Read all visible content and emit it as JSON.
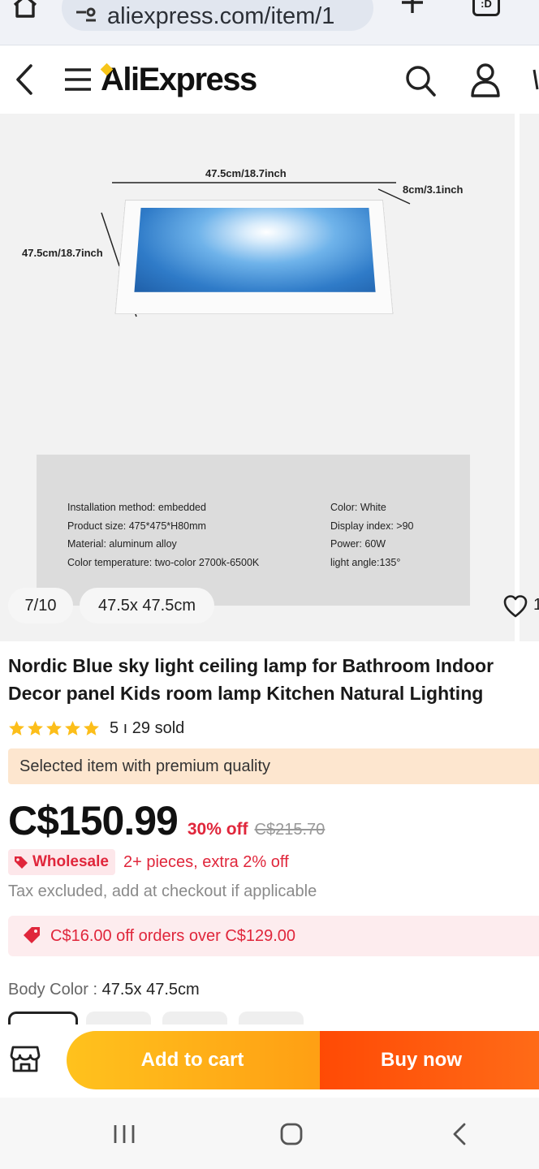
{
  "browser": {
    "url": "aliexpress.com/item/1",
    "tabs_label": ":D"
  },
  "header": {
    "logo": "AliExpress"
  },
  "gallery": {
    "dimension_top": "47.5cm/18.7inch",
    "dimension_left": "47.5cm/18.7inch",
    "dimension_depth": "8cm/3.1inch",
    "specs_left": [
      "Installation method: embedded",
      "Product size: 475*475*H80mm",
      "Material: aluminum alloy",
      "Color temperature: two-color 2700k-6500K"
    ],
    "specs_right": [
      "Color: White",
      "Display index: >90",
      "Power: 60W",
      "light angle:135°"
    ],
    "counter": "7/10",
    "variant_chip": "47.5x 47.5cm",
    "wishlist_count": "1"
  },
  "product": {
    "title": "Nordic Blue sky light ceiling lamp for Bathroom Indoor Decor panel Kids room lamp Kitchen Natural Lighting",
    "rating_stars": 5,
    "rating_text": "5 ı 29 sold",
    "premium_banner": "Selected item with premium quality",
    "price": "C$150.99",
    "discount": "30% off",
    "old_price": "C$215.70",
    "wholesale_badge": "Wholesale",
    "wholesale_text": "2+ pieces, extra 2% off",
    "tax_note": "Tax excluded, add at checkout if applicable",
    "coupon": "C$16.00 off orders over C$129.00",
    "color_label": "Body Color : ",
    "color_value": "47.5x 47.5cm"
  },
  "actions": {
    "add_to_cart": "Add to cart",
    "buy_now": "Buy now"
  },
  "colors": {
    "accent_red": "#e0263b",
    "cart_yellow": "#ffc21d",
    "buy_orange": "#ff4a05",
    "premium_bg": "#fde6cf"
  }
}
